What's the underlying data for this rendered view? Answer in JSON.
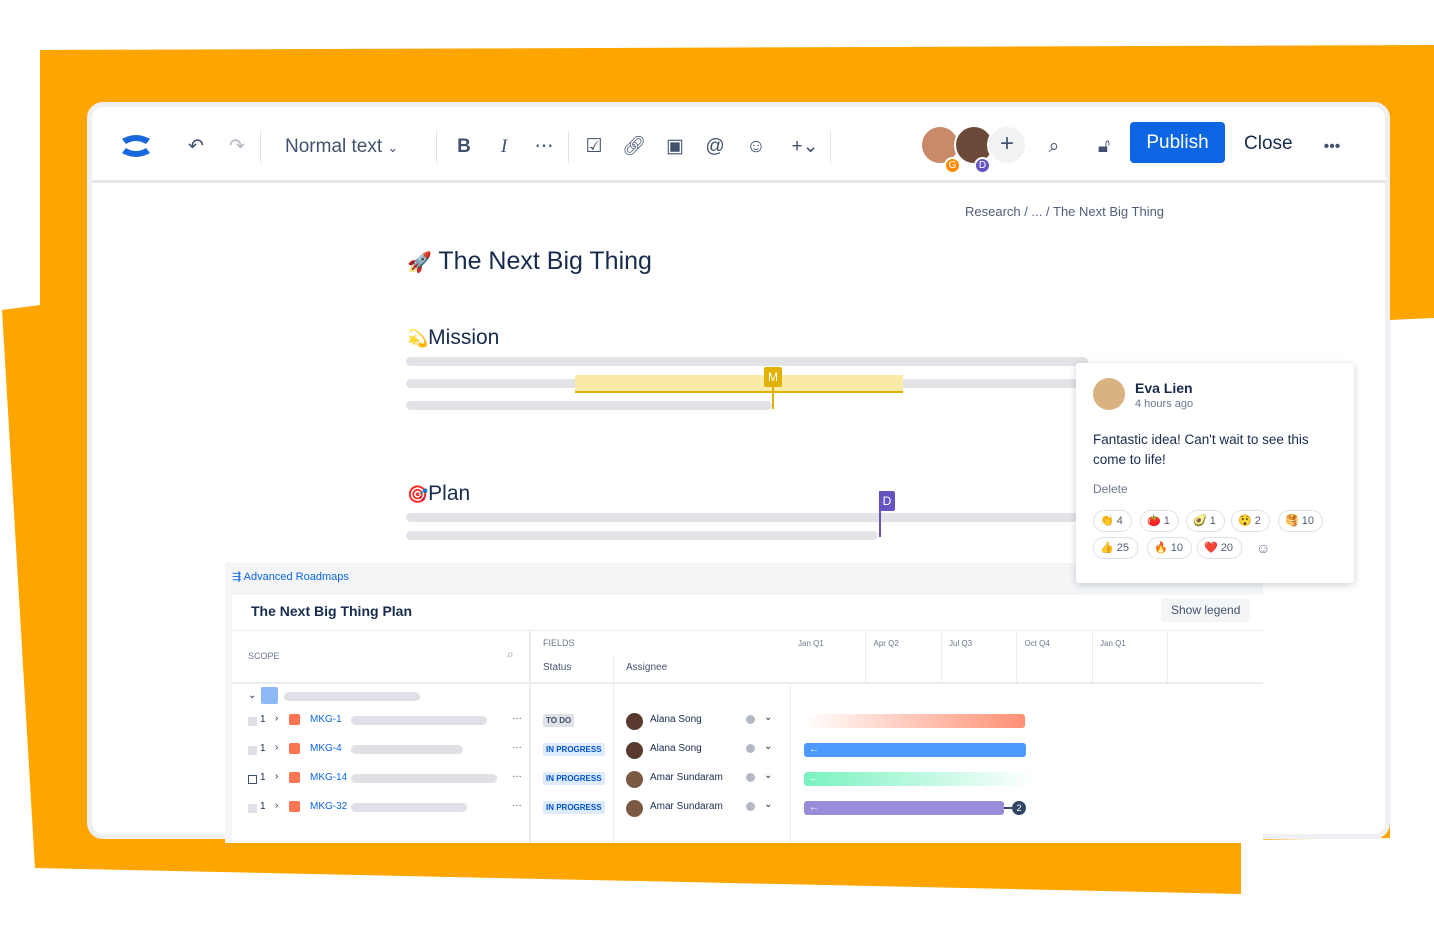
{
  "colors": {
    "brand_orange": "#ffa500",
    "accent_blue": "#0c66e4"
  },
  "toolbar": {
    "text_style": "Normal text",
    "publish": "Publish",
    "close": "Close",
    "more": "•••",
    "collaborators": [
      {
        "initial": "G",
        "color": "#ff8b00"
      },
      {
        "initial": "D",
        "color": "#6554c0"
      }
    ],
    "icons": [
      "confluence-logo",
      "undo-icon",
      "redo-icon",
      "chevron-down-icon",
      "bold-icon",
      "italic-icon",
      "more-icon",
      "checkbox-icon",
      "link-icon",
      "image-icon",
      "mention-icon",
      "emoji-icon",
      "plus-icon",
      "search-icon",
      "unlock-icon"
    ]
  },
  "breadcrumb": {
    "items": [
      "Research",
      "...",
      "The Next Big Thing"
    ],
    "sep": "/"
  },
  "page": {
    "title": "The Next Big Thing",
    "title_emoji": "🚀",
    "sections": [
      {
        "emoji": "💫",
        "heading": "Mission",
        "marker": "M"
      },
      {
        "emoji": "🎯",
        "heading": "Plan",
        "marker": "D"
      }
    ]
  },
  "comment": {
    "author": "Eva Lien",
    "time": "4 hours ago",
    "text": "Fantastic idea! Can't wait to see this come to life!",
    "delete": "Delete",
    "reactions": [
      {
        "emoji": "👏",
        "count": "4"
      },
      {
        "emoji": "🍅",
        "count": "1"
      },
      {
        "emoji": "🥑",
        "count": "1"
      },
      {
        "emoji": "😲",
        "count": "2"
      },
      {
        "emoji": "🥞",
        "count": "10"
      },
      {
        "emoji": "👍",
        "count": "25"
      },
      {
        "emoji": "🔥",
        "count": "10"
      },
      {
        "emoji": "❤️",
        "count": "20"
      }
    ]
  },
  "roadmap": {
    "app": "Advanced Roadmaps",
    "title": "The Next Big Thing Plan",
    "show_legend": "Show legend",
    "scope": "SCOPE",
    "fields": "FIELDS",
    "status_col": "Status",
    "assignee_col": "Assignee",
    "quarters": [
      "Jan Q1",
      "Apr Q2",
      "Jul Q3",
      "Oct Q4",
      "Jan Q1"
    ],
    "rows": [
      {
        "count": "1",
        "key": "MKG-1",
        "status": "TO DO",
        "assignee": "Alana Song",
        "bar_color": "#ff8f73"
      },
      {
        "count": "1",
        "key": "MKG-4",
        "status": "IN PROGRESS",
        "assignee": "Alana Song",
        "bar_color": "#4c9aff"
      },
      {
        "count": "1",
        "key": "MKG-14",
        "status": "IN PROGRESS",
        "assignee": "Amar Sundaram",
        "bar_color": "#79f2c0"
      },
      {
        "count": "1",
        "key": "MKG-32",
        "status": "IN PROGRESS",
        "assignee": "Amar Sundaram",
        "bar_color": "#998dd9",
        "dependency_count": "2"
      }
    ]
  }
}
